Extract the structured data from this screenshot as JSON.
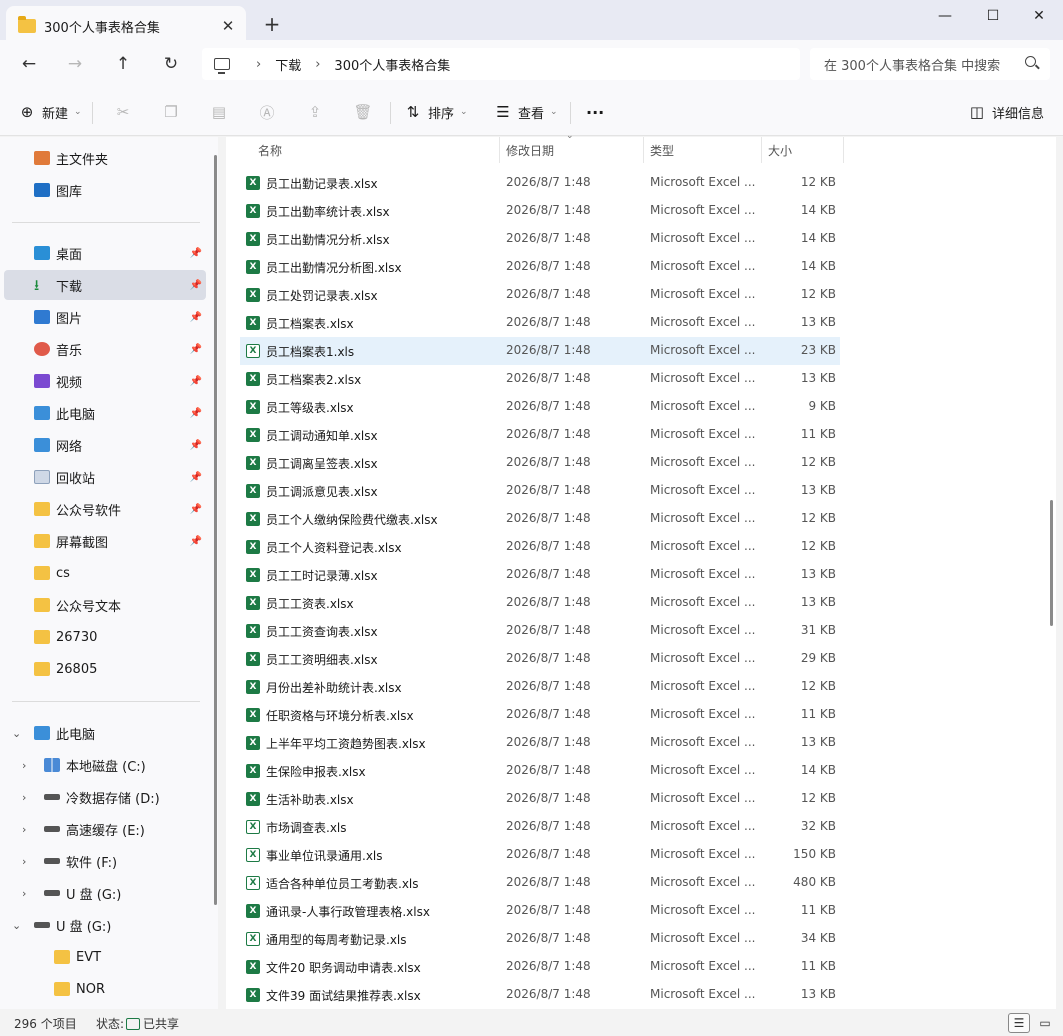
{
  "window": {
    "tab_title": "300个人事表格合集",
    "new_tab": "+",
    "tab_close": "✕",
    "minimize": "—",
    "maximize": "☐",
    "close": "✕"
  },
  "nav": {
    "back": "←",
    "forward": "→",
    "up": "↑",
    "refresh": "↻",
    "breadcrumb": [
      "下载",
      "300个人事表格合集"
    ],
    "breadcrumb_sep": "›",
    "search_placeholder": "在 300个人事表格合集 中搜索"
  },
  "toolbar": {
    "new_label": "新建",
    "sort_label": "排序",
    "view_label": "查看",
    "more": "···",
    "details_label": "详细信息"
  },
  "sidebar": {
    "quick": [
      {
        "label": "主文件夹",
        "icon": "home-icon"
      },
      {
        "label": "图库",
        "icon": "gallery-icon"
      }
    ],
    "pinned": [
      {
        "label": "桌面",
        "icon": "desktop-icon",
        "pinned": true
      },
      {
        "label": "下载",
        "icon": "download-icon",
        "pinned": true,
        "selected": true
      },
      {
        "label": "图片",
        "icon": "pictures-icon",
        "pinned": true
      },
      {
        "label": "音乐",
        "icon": "music-icon",
        "pinned": true
      },
      {
        "label": "视频",
        "icon": "video-icon",
        "pinned": true
      },
      {
        "label": "此电脑",
        "icon": "computer-icon",
        "pinned": true
      },
      {
        "label": "网络",
        "icon": "network-icon",
        "pinned": true
      },
      {
        "label": "回收站",
        "icon": "recycle-bin-icon",
        "pinned": true
      },
      {
        "label": "公众号软件",
        "icon": "folder-icon",
        "pinned": true
      },
      {
        "label": "屏幕截图",
        "icon": "folder-icon",
        "pinned": true
      },
      {
        "label": "cs",
        "icon": "folder-icon",
        "pinned": false
      },
      {
        "label": "公众号文本",
        "icon": "folder-icon",
        "pinned": false
      },
      {
        "label": "26730",
        "icon": "folder-icon",
        "pinned": false
      },
      {
        "label": "26805",
        "icon": "folder-icon",
        "pinned": false
      }
    ],
    "tree": [
      {
        "label": "此电脑",
        "icon": "computer-icon",
        "chevron": "⌄",
        "indent": 0
      },
      {
        "label": "本地磁盘 (C:)",
        "icon": "windows-drive-icon",
        "chevron": "›",
        "indent": 1
      },
      {
        "label": "冷数据存储 (D:)",
        "icon": "drive-icon",
        "chevron": "›",
        "indent": 1
      },
      {
        "label": "高速缓存 (E:)",
        "icon": "drive-icon",
        "chevron": "›",
        "indent": 1
      },
      {
        "label": "软件 (F:)",
        "icon": "drive-icon",
        "chevron": "›",
        "indent": 1
      },
      {
        "label": "U 盘 (G:)",
        "icon": "drive-icon",
        "chevron": "›",
        "indent": 1
      },
      {
        "label": "U 盘 (G:)",
        "icon": "drive-icon",
        "chevron": "⌄",
        "indent": 0
      },
      {
        "label": "EVT",
        "icon": "folder-icon",
        "chevron": "",
        "indent": 2
      },
      {
        "label": "NOR",
        "icon": "folder-icon",
        "chevron": "",
        "indent": 2
      }
    ]
  },
  "list": {
    "columns": {
      "name": "名称",
      "date": "修改日期",
      "type": "类型",
      "size": "大小"
    },
    "files": [
      {
        "name": "员工出勤记录表.xlsx",
        "date": "2026/8/7 1:48",
        "type": "Microsoft Excel ...",
        "size": "12 KB",
        "ext": "xlsx"
      },
      {
        "name": "员工出勤率统计表.xlsx",
        "date": "2026/8/7 1:48",
        "type": "Microsoft Excel ...",
        "size": "14 KB",
        "ext": "xlsx"
      },
      {
        "name": "员工出勤情况分析.xlsx",
        "date": "2026/8/7 1:48",
        "type": "Microsoft Excel ...",
        "size": "14 KB",
        "ext": "xlsx"
      },
      {
        "name": "员工出勤情况分析图.xlsx",
        "date": "2026/8/7 1:48",
        "type": "Microsoft Excel ...",
        "size": "14 KB",
        "ext": "xlsx"
      },
      {
        "name": "员工处罚记录表.xlsx",
        "date": "2026/8/7 1:48",
        "type": "Microsoft Excel ...",
        "size": "12 KB",
        "ext": "xlsx"
      },
      {
        "name": "员工档案表.xlsx",
        "date": "2026/8/7 1:48",
        "type": "Microsoft Excel ...",
        "size": "13 KB",
        "ext": "xlsx"
      },
      {
        "name": "员工档案表1.xls",
        "date": "2026/8/7 1:48",
        "type": "Microsoft Excel ...",
        "size": "23 KB",
        "ext": "xls",
        "hover": true
      },
      {
        "name": "员工档案表2.xlsx",
        "date": "2026/8/7 1:48",
        "type": "Microsoft Excel ...",
        "size": "13 KB",
        "ext": "xlsx"
      },
      {
        "name": "员工等级表.xlsx",
        "date": "2026/8/7 1:48",
        "type": "Microsoft Excel ...",
        "size": "9 KB",
        "ext": "xlsx"
      },
      {
        "name": "员工调动通知单.xlsx",
        "date": "2026/8/7 1:48",
        "type": "Microsoft Excel ...",
        "size": "11 KB",
        "ext": "xlsx"
      },
      {
        "name": "员工调离呈签表.xlsx",
        "date": "2026/8/7 1:48",
        "type": "Microsoft Excel ...",
        "size": "12 KB",
        "ext": "xlsx"
      },
      {
        "name": "员工调派意见表.xlsx",
        "date": "2026/8/7 1:48",
        "type": "Microsoft Excel ...",
        "size": "13 KB",
        "ext": "xlsx"
      },
      {
        "name": "员工个人缴纳保险费代缴表.xlsx",
        "date": "2026/8/7 1:48",
        "type": "Microsoft Excel ...",
        "size": "12 KB",
        "ext": "xlsx"
      },
      {
        "name": "员工个人资料登记表.xlsx",
        "date": "2026/8/7 1:48",
        "type": "Microsoft Excel ...",
        "size": "12 KB",
        "ext": "xlsx"
      },
      {
        "name": "员工工时记录薄.xlsx",
        "date": "2026/8/7 1:48",
        "type": "Microsoft Excel ...",
        "size": "13 KB",
        "ext": "xlsx"
      },
      {
        "name": "员工工资表.xlsx",
        "date": "2026/8/7 1:48",
        "type": "Microsoft Excel ...",
        "size": "13 KB",
        "ext": "xlsx"
      },
      {
        "name": "员工工资查询表.xlsx",
        "date": "2026/8/7 1:48",
        "type": "Microsoft Excel ...",
        "size": "31 KB",
        "ext": "xlsx"
      },
      {
        "name": "员工工资明细表.xlsx",
        "date": "2026/8/7 1:48",
        "type": "Microsoft Excel ...",
        "size": "29 KB",
        "ext": "xlsx"
      },
      {
        "name": "月份出差补助统计表.xlsx",
        "date": "2026/8/7 1:48",
        "type": "Microsoft Excel ...",
        "size": "12 KB",
        "ext": "xlsx"
      },
      {
        "name": "任职资格与环境分析表.xlsx",
        "date": "2026/8/7 1:48",
        "type": "Microsoft Excel ...",
        "size": "11 KB",
        "ext": "xlsx"
      },
      {
        "name": "上半年平均工资趋势图表.xlsx",
        "date": "2026/8/7 1:48",
        "type": "Microsoft Excel ...",
        "size": "13 KB",
        "ext": "xlsx"
      },
      {
        "name": "生保险申报表.xlsx",
        "date": "2026/8/7 1:48",
        "type": "Microsoft Excel ...",
        "size": "14 KB",
        "ext": "xlsx"
      },
      {
        "name": "生活补助表.xlsx",
        "date": "2026/8/7 1:48",
        "type": "Microsoft Excel ...",
        "size": "12 KB",
        "ext": "xlsx"
      },
      {
        "name": "市场调查表.xls",
        "date": "2026/8/7 1:48",
        "type": "Microsoft Excel ...",
        "size": "32 KB",
        "ext": "xls"
      },
      {
        "name": "事业单位讯录通用.xls",
        "date": "2026/8/7 1:48",
        "type": "Microsoft Excel ...",
        "size": "150 KB",
        "ext": "xls"
      },
      {
        "name": "适合各种单位员工考勤表.xls",
        "date": "2026/8/7 1:48",
        "type": "Microsoft Excel ...",
        "size": "480 KB",
        "ext": "xls"
      },
      {
        "name": "通讯录-人事行政管理表格.xlsx",
        "date": "2026/8/7 1:48",
        "type": "Microsoft Excel ...",
        "size": "11 KB",
        "ext": "xlsx"
      },
      {
        "name": "通用型的每周考勤记录.xls",
        "date": "2026/8/7 1:48",
        "type": "Microsoft Excel ...",
        "size": "34 KB",
        "ext": "xls"
      },
      {
        "name": "文件20  职务调动申请表.xlsx",
        "date": "2026/8/7 1:48",
        "type": "Microsoft Excel ...",
        "size": "11 KB",
        "ext": "xlsx"
      },
      {
        "name": "文件39  面试结果推荐表.xlsx",
        "date": "2026/8/7 1:48",
        "type": "Microsoft Excel ...",
        "size": "13 KB",
        "ext": "xlsx"
      }
    ]
  },
  "status": {
    "count": "296 个项目",
    "state_label": "状态:",
    "share_label": "已共享"
  }
}
